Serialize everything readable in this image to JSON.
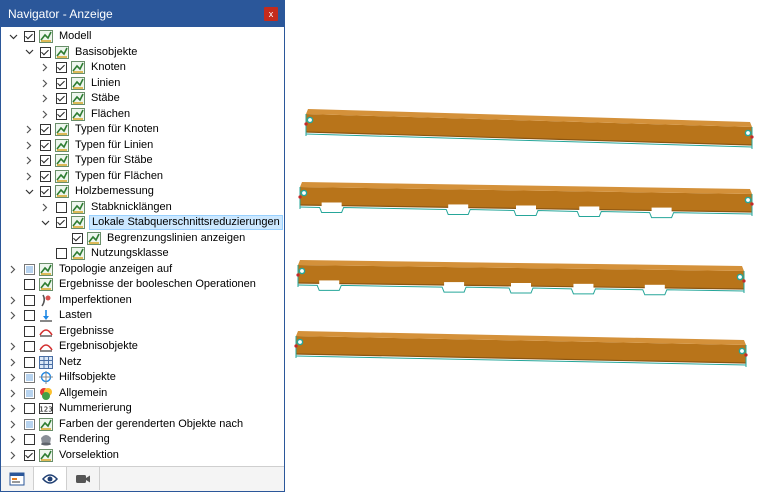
{
  "window": {
    "title": "Navigator - Anzeige",
    "close_label": "x"
  },
  "tree": [
    {
      "label": "Modell",
      "level": 0,
      "expander": "open",
      "check": "checked",
      "icon": "model-icon"
    },
    {
      "label": "Basisobjekte",
      "level": 1,
      "expander": "open",
      "check": "checked",
      "icon": "model-icon"
    },
    {
      "label": "Knoten",
      "level": 2,
      "expander": "closed",
      "check": "checked",
      "icon": "model-icon"
    },
    {
      "label": "Linien",
      "level": 2,
      "expander": "closed",
      "check": "checked",
      "icon": "model-icon"
    },
    {
      "label": "Stäbe",
      "level": 2,
      "expander": "closed",
      "check": "checked",
      "icon": "model-icon"
    },
    {
      "label": "Flächen",
      "level": 2,
      "expander": "closed",
      "check": "checked",
      "icon": "model-icon"
    },
    {
      "label": "Typen für Knoten",
      "level": 1,
      "expander": "closed",
      "check": "checked",
      "icon": "model-icon"
    },
    {
      "label": "Typen für Linien",
      "level": 1,
      "expander": "closed",
      "check": "checked",
      "icon": "model-icon"
    },
    {
      "label": "Typen für Stäbe",
      "level": 1,
      "expander": "closed",
      "check": "checked",
      "icon": "model-icon"
    },
    {
      "label": "Typen für Flächen",
      "level": 1,
      "expander": "closed",
      "check": "checked",
      "icon": "model-icon"
    },
    {
      "label": "Holzbemessung",
      "level": 1,
      "expander": "open",
      "check": "checked",
      "icon": "model-icon"
    },
    {
      "label": "Stabknicklängen",
      "level": 2,
      "expander": "closed",
      "check": "unchecked",
      "icon": "model-icon"
    },
    {
      "label": "Lokale Stabquerschnittsreduzierungen",
      "level": 2,
      "expander": "open",
      "check": "checked",
      "icon": "model-icon",
      "selected": true
    },
    {
      "label": "Begrenzungslinien anzeigen",
      "level": 3,
      "expander": "none",
      "check": "checked",
      "icon": "model-icon"
    },
    {
      "label": "Nutzungsklasse",
      "level": 2,
      "expander": "none",
      "check": "unchecked",
      "icon": "model-icon"
    },
    {
      "label": "Topologie anzeigen auf",
      "level": 0,
      "expander": "closed",
      "check": "partial",
      "icon": "model-icon"
    },
    {
      "label": "Ergebnisse der booleschen Operationen",
      "level": 0,
      "expander": "none",
      "check": "unchecked",
      "icon": "model-icon"
    },
    {
      "label": "Imperfektionen",
      "level": 0,
      "expander": "closed",
      "check": "unchecked",
      "icon": "imperfection-icon"
    },
    {
      "label": "Lasten",
      "level": 0,
      "expander": "closed",
      "check": "unchecked",
      "icon": "load-icon"
    },
    {
      "label": "Ergebnisse",
      "level": 0,
      "expander": "none",
      "check": "unchecked",
      "icon": "results-icon"
    },
    {
      "label": "Ergebnisobjekte",
      "level": 0,
      "expander": "closed",
      "check": "unchecked",
      "icon": "results-icon"
    },
    {
      "label": "Netz",
      "level": 0,
      "expander": "closed",
      "check": "unchecked",
      "icon": "mesh-icon"
    },
    {
      "label": "Hilfsobjekte",
      "level": 0,
      "expander": "closed",
      "check": "partial",
      "icon": "guide-objects-icon"
    },
    {
      "label": "Allgemein",
      "level": 0,
      "expander": "closed",
      "check": "partial",
      "icon": "general-icon"
    },
    {
      "label": "Nummerierung",
      "level": 0,
      "expander": "closed",
      "check": "unchecked",
      "icon": "numbering-icon"
    },
    {
      "label": "Farben der gerenderten Objekte nach",
      "level": 0,
      "expander": "closed",
      "check": "partial",
      "icon": "model-icon"
    },
    {
      "label": "Rendering",
      "level": 0,
      "expander": "closed",
      "check": "unchecked",
      "icon": "rendering-icon"
    },
    {
      "label": "Vorselektion",
      "level": 0,
      "expander": "closed",
      "check": "checked",
      "icon": "model-icon"
    }
  ],
  "bottom_tabs": [
    {
      "icon": "data-tab-icon"
    },
    {
      "icon": "display-eye-icon",
      "active": true
    },
    {
      "icon": "views-camera-icon"
    }
  ],
  "colors": {
    "accent": "#2b579a",
    "member": "#b8741a",
    "member_dark": "#8a5512",
    "node": "#26a69a",
    "selection": "#cce8ff"
  },
  "members": [
    {
      "name": "member-1",
      "cuts": []
    },
    {
      "name": "member-2",
      "cuts": [
        0.07,
        0.35,
        0.5,
        0.64,
        0.8
      ]
    },
    {
      "name": "member-3",
      "cuts": [
        0.07,
        0.35,
        0.5,
        0.64,
        0.8
      ]
    },
    {
      "name": "member-4",
      "cuts": []
    }
  ]
}
